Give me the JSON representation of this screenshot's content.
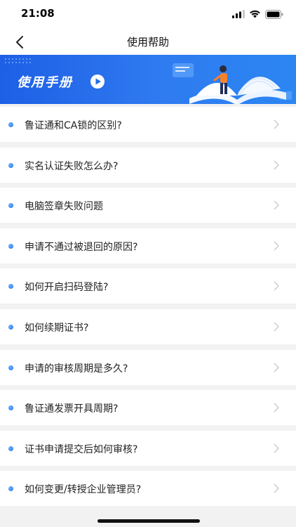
{
  "status_bar": {
    "time": "21:08"
  },
  "nav": {
    "title": "使用帮助"
  },
  "banner": {
    "title": "使用手册"
  },
  "help_items": [
    {
      "label": "鲁证通和CA锁的区别?"
    },
    {
      "label": "实名认证失败怎么办?"
    },
    {
      "label": "电脑签章失败问题"
    },
    {
      "label": "申请不通过被退回的原因?"
    },
    {
      "label": "如何开启扫码登陆?"
    },
    {
      "label": "如何续期证书?"
    },
    {
      "label": "申请的审核周期是多久?"
    },
    {
      "label": "鲁证通发票开具周期?"
    },
    {
      "label": "证书申请提交后如何审核?"
    },
    {
      "label": "如何变更/转授企业管理员?"
    }
  ],
  "colors": {
    "accent": "#1e6fe8",
    "chevron": "#c8c8c8"
  }
}
